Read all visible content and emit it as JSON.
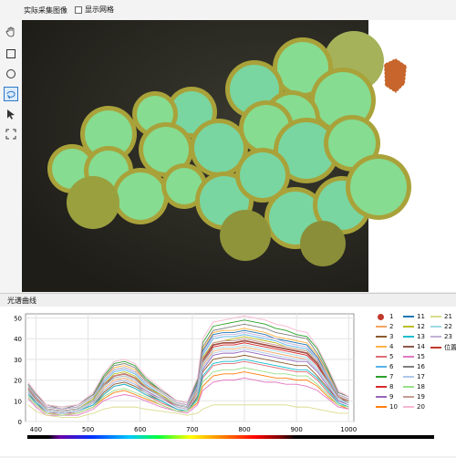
{
  "top": {
    "title": "实际采集图像",
    "checkbox_label": "显示网格"
  },
  "toolbar": {
    "icons": [
      "hand-icon",
      "rectangle-icon",
      "ellipse-icon",
      "lasso-icon",
      "pointer-icon",
      "fit-icon"
    ]
  },
  "spectrum": {
    "title": "光谱曲线"
  },
  "legend": {
    "col1": [
      "1",
      "2",
      "3",
      "4",
      "5",
      "6",
      "7",
      "8",
      "9",
      "10"
    ],
    "col2": [
      "11",
      "12",
      "13",
      "14",
      "15",
      "16",
      "17",
      "18",
      "19",
      "20"
    ],
    "col3": [
      "21",
      "22",
      "23",
      "位置 ("
    ]
  },
  "colors": [
    "#c0392b",
    "#f4a460",
    "#8b5a2b",
    "#ffb347",
    "#e06c75",
    "#56b4e9",
    "#2ca02c",
    "#d62728",
    "#9467bd",
    "#ff7f0e",
    "#1f77b4",
    "#bcbd22",
    "#17becf",
    "#8c564b",
    "#e377c2",
    "#7f7f7f",
    "#aec7e8",
    "#98df8a",
    "#c49c94",
    "#f7b6d2",
    "#dbdb8d",
    "#9edae5",
    "#c5b0d5"
  ],
  "chart_data": {
    "type": "line",
    "xlim": [
      380,
      1010
    ],
    "ylim": [
      0,
      52
    ],
    "xticks": [
      400,
      500,
      600,
      700,
      800,
      900,
      1000
    ],
    "yticks": [
      0,
      10,
      20,
      30,
      40,
      50
    ],
    "x": [
      385,
      400,
      420,
      450,
      480,
      510,
      530,
      550,
      570,
      590,
      610,
      640,
      670,
      690,
      710,
      720,
      740,
      760,
      780,
      800,
      820,
      840,
      860,
      880,
      900,
      920,
      940,
      960,
      980,
      1000
    ],
    "series": [
      {
        "name": "1",
        "values": [
          16,
          11,
          6,
          5,
          6,
          10,
          18,
          22,
          23,
          21,
          17,
          12,
          8,
          7,
          16,
          30,
          37,
          38,
          38,
          39,
          38,
          37,
          36,
          35,
          34,
          33,
          28,
          20,
          12,
          10
        ]
      },
      {
        "name": "2",
        "values": [
          15,
          10,
          5,
          4,
          5,
          9,
          16,
          20,
          21,
          19,
          15,
          11,
          7,
          6,
          14,
          27,
          34,
          35,
          35,
          36,
          35,
          34,
          33,
          32,
          31,
          30,
          25,
          18,
          11,
          9
        ]
      },
      {
        "name": "3",
        "values": [
          14,
          9,
          5,
          4,
          5,
          8,
          14,
          18,
          19,
          17,
          14,
          10,
          6,
          5,
          12,
          24,
          30,
          31,
          31,
          32,
          31,
          30,
          29,
          28,
          27,
          27,
          22,
          16,
          10,
          8
        ]
      },
      {
        "name": "4",
        "values": [
          17,
          12,
          7,
          6,
          7,
          12,
          21,
          26,
          27,
          25,
          20,
          14,
          9,
          8,
          18,
          35,
          43,
          44,
          44,
          45,
          44,
          43,
          41,
          40,
          39,
          38,
          32,
          23,
          13,
          11
        ]
      },
      {
        "name": "5",
        "values": [
          13,
          9,
          4,
          4,
          4,
          7,
          13,
          17,
          18,
          16,
          13,
          9,
          6,
          5,
          11,
          21,
          27,
          28,
          28,
          29,
          28,
          27,
          26,
          25,
          24,
          24,
          20,
          14,
          9,
          7
        ]
      },
      {
        "name": "6",
        "values": [
          16,
          11,
          6,
          5,
          6,
          11,
          19,
          24,
          25,
          23,
          18,
          13,
          8,
          7,
          17,
          32,
          40,
          41,
          41,
          42,
          41,
          40,
          39,
          37,
          36,
          35,
          30,
          21,
          12,
          10
        ]
      },
      {
        "name": "7",
        "values": [
          18,
          13,
          8,
          7,
          8,
          13,
          22,
          28,
          29,
          27,
          21,
          15,
          10,
          9,
          20,
          38,
          46,
          47,
          48,
          49,
          48,
          47,
          45,
          44,
          42,
          41,
          35,
          25,
          14,
          12
        ]
      },
      {
        "name": "8",
        "values": [
          15,
          10,
          6,
          5,
          6,
          10,
          17,
          21,
          22,
          20,
          16,
          12,
          7,
          6,
          15,
          28,
          36,
          37,
          37,
          38,
          37,
          36,
          35,
          34,
          33,
          32,
          27,
          19,
          11,
          9
        ]
      },
      {
        "name": "9",
        "values": [
          14,
          10,
          5,
          4,
          5,
          9,
          15,
          19,
          20,
          18,
          15,
          11,
          7,
          6,
          13,
          25,
          32,
          33,
          33,
          34,
          33,
          32,
          31,
          30,
          29,
          29,
          24,
          17,
          10,
          8
        ]
      },
      {
        "name": "10",
        "values": [
          12,
          8,
          4,
          3,
          4,
          7,
          11,
          14,
          15,
          13,
          11,
          8,
          5,
          5,
          9,
          17,
          22,
          23,
          23,
          24,
          23,
          22,
          21,
          21,
          20,
          20,
          17,
          12,
          8,
          6
        ]
      },
      {
        "name": "11",
        "values": [
          17,
          12,
          7,
          6,
          7,
          12,
          20,
          25,
          26,
          24,
          19,
          14,
          9,
          8,
          18,
          34,
          42,
          43,
          43,
          44,
          43,
          42,
          40,
          39,
          38,
          37,
          31,
          22,
          13,
          11
        ]
      },
      {
        "name": "12",
        "values": [
          16,
          11,
          6,
          5,
          6,
          11,
          18,
          23,
          24,
          22,
          17,
          13,
          8,
          7,
          16,
          31,
          38,
          39,
          40,
          41,
          40,
          39,
          38,
          36,
          35,
          34,
          29,
          20,
          12,
          10
        ]
      },
      {
        "name": "13",
        "values": [
          13,
          9,
          5,
          4,
          5,
          8,
          13,
          17,
          18,
          16,
          13,
          10,
          6,
          5,
          11,
          22,
          28,
          29,
          29,
          30,
          29,
          28,
          27,
          26,
          25,
          25,
          21,
          15,
          9,
          7
        ]
      },
      {
        "name": "14",
        "values": [
          15,
          11,
          6,
          5,
          6,
          10,
          17,
          22,
          23,
          21,
          16,
          12,
          8,
          7,
          15,
          29,
          37,
          38,
          38,
          39,
          38,
          37,
          36,
          35,
          34,
          33,
          28,
          20,
          12,
          9
        ]
      },
      {
        "name": "15",
        "values": [
          11,
          7,
          3,
          3,
          3,
          6,
          10,
          12,
          13,
          12,
          10,
          7,
          5,
          4,
          8,
          15,
          19,
          20,
          20,
          21,
          20,
          19,
          19,
          18,
          18,
          17,
          15,
          11,
          7,
          6
        ]
      },
      {
        "name": "16",
        "values": [
          18,
          13,
          8,
          6,
          8,
          13,
          21,
          27,
          28,
          26,
          20,
          15,
          10,
          9,
          19,
          36,
          44,
          45,
          46,
          47,
          46,
          45,
          43,
          42,
          41,
          40,
          33,
          24,
          14,
          12
        ]
      },
      {
        "name": "17",
        "values": [
          14,
          10,
          5,
          4,
          5,
          9,
          15,
          19,
          20,
          18,
          14,
          11,
          7,
          6,
          13,
          26,
          33,
          34,
          34,
          35,
          34,
          33,
          32,
          31,
          30,
          30,
          25,
          18,
          11,
          8
        ]
      },
      {
        "name": "18",
        "values": [
          12,
          8,
          4,
          3,
          4,
          7,
          12,
          15,
          16,
          14,
          12,
          8,
          5,
          5,
          10,
          19,
          24,
          25,
          25,
          26,
          25,
          24,
          23,
          23,
          22,
          22,
          18,
          13,
          8,
          7
        ]
      },
      {
        "name": "19",
        "values": [
          16,
          11,
          6,
          5,
          6,
          10,
          18,
          22,
          23,
          21,
          17,
          12,
          8,
          7,
          16,
          30,
          38,
          39,
          39,
          40,
          39,
          38,
          37,
          36,
          35,
          34,
          29,
          20,
          12,
          10
        ]
      },
      {
        "name": "20",
        "values": [
          19,
          14,
          8,
          7,
          8,
          14,
          23,
          29,
          30,
          28,
          22,
          16,
          10,
          9,
          21,
          40,
          48,
          49,
          50,
          51,
          50,
          49,
          47,
          46,
          44,
          43,
          36,
          26,
          15,
          12
        ]
      },
      {
        "name": "21",
        "values": [
          8,
          5,
          3,
          2,
          2,
          4,
          6,
          7,
          7,
          7,
          6,
          5,
          4,
          3,
          4,
          6,
          8,
          8,
          8,
          8,
          8,
          8,
          8,
          8,
          7,
          7,
          6,
          5,
          4,
          4
        ]
      },
      {
        "name": "22",
        "values": [
          15,
          10,
          6,
          5,
          6,
          10,
          17,
          21,
          22,
          20,
          16,
          12,
          8,
          7,
          15,
          28,
          35,
          36,
          36,
          37,
          36,
          35,
          34,
          33,
          32,
          31,
          26,
          19,
          11,
          9
        ]
      },
      {
        "name": "23",
        "values": [
          17,
          12,
          7,
          6,
          7,
          12,
          20,
          25,
          26,
          24,
          19,
          14,
          9,
          8,
          17,
          33,
          41,
          42,
          42,
          43,
          42,
          41,
          40,
          38,
          37,
          36,
          30,
          22,
          13,
          11
        ]
      }
    ]
  }
}
